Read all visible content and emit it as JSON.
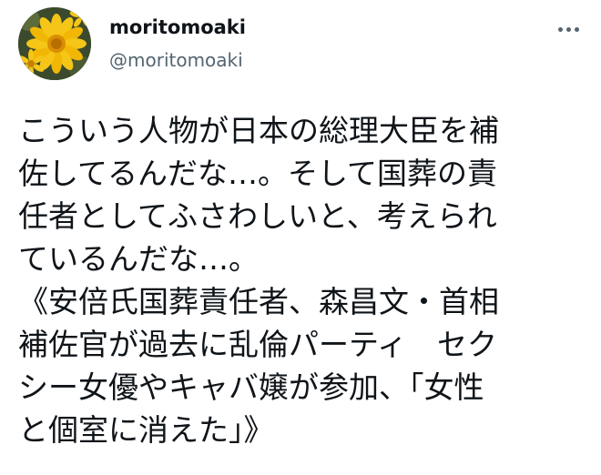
{
  "author": {
    "display_name": "moritomoaki",
    "handle": "@moritomoaki",
    "avatar_icon": "sunflower-avatar-icon"
  },
  "more_button": {
    "icon": "more-horizontal-icon"
  },
  "tweet": {
    "lines": [
      "こういう人物が日本の総理大臣を補",
      "佐してるんだな…。そして国葬の責",
      "任者としてふさわしいと、考えられ",
      "ているんだな…。",
      "《安倍氏国葬責任者、森昌文・首相",
      "補佐官が過去に乱倫パーティ　セク",
      "シー女優やキャバ嬢が参加、「女性",
      "と個室に消えた」》"
    ]
  },
  "colors": {
    "text_primary": "#0f1419",
    "text_secondary": "#536471",
    "background": "#ffffff"
  }
}
